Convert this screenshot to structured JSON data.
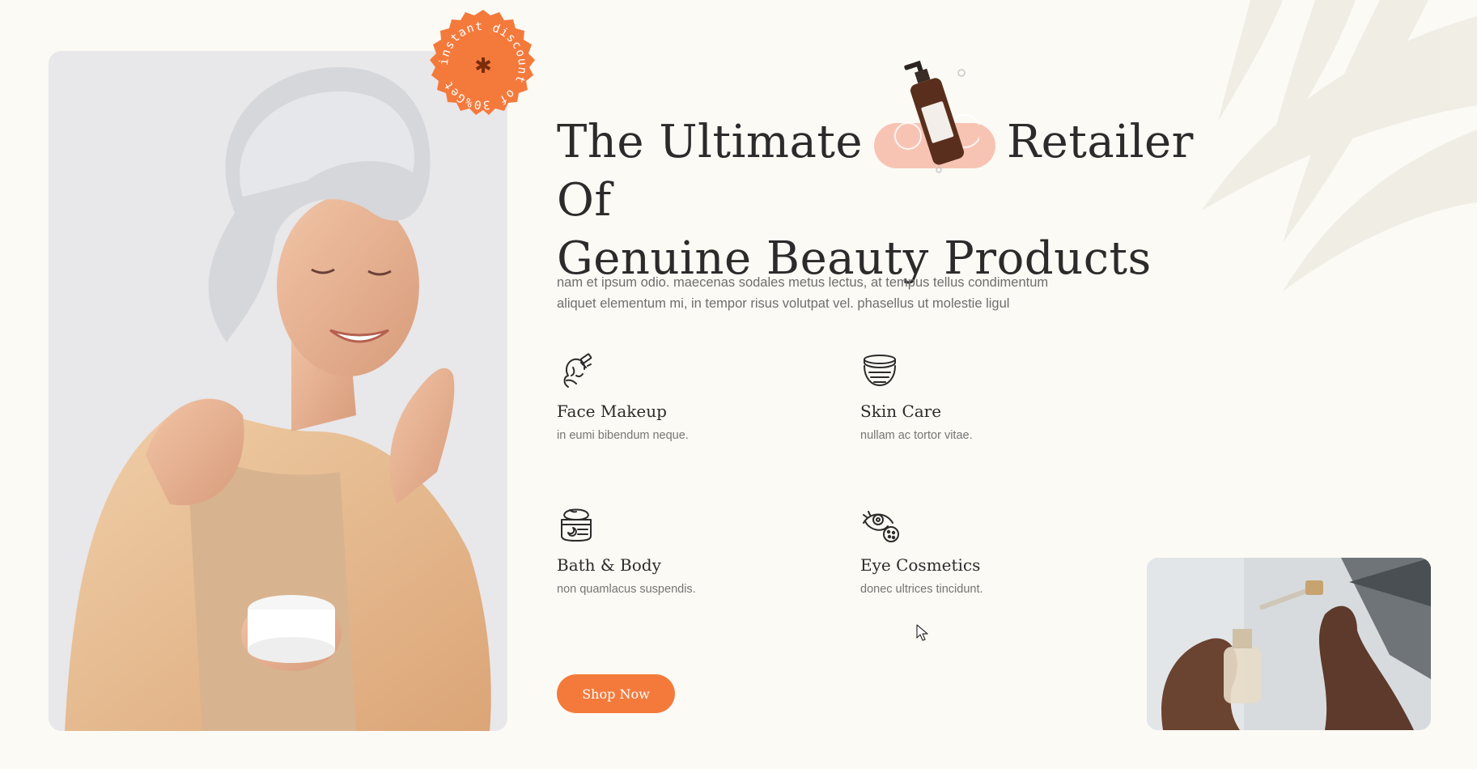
{
  "badge": {
    "ring_text": "instant discount of 30%Get",
    "center_glyph": "✱",
    "color": "#f47a3c"
  },
  "hero": {
    "title_line1_part1": "The Ultimate",
    "title_line1_part2": "Retailer Of",
    "title_line2": "Genuine Beauty Products",
    "description": "nam et ipsum odio. maecenas sodales metus lectus, at tempus tellus condimentum aliquet elementum mi, in tempor risus volutpat vel. phasellus ut molestie ligul"
  },
  "features": [
    {
      "icon": "face-makeup-icon",
      "title": "Face Makeup",
      "subtitle": "in eumi bibendum neque."
    },
    {
      "icon": "skin-care-icon",
      "title": "Skin Care",
      "subtitle": "nullam ac tortor vitae."
    },
    {
      "icon": "bath-body-icon",
      "title": "Bath & Body",
      "subtitle": "non quamlacus suspendis."
    },
    {
      "icon": "eye-cosmetics-icon",
      "title": "Eye Cosmetics",
      "subtitle": "donec ultrices tincidunt."
    }
  ],
  "cta": {
    "label": "Shop Now"
  },
  "colors": {
    "accent": "#f47a3c",
    "background": "#fcfaf5",
    "text": "#2b2b2b",
    "pill": "#f7c4b4"
  }
}
